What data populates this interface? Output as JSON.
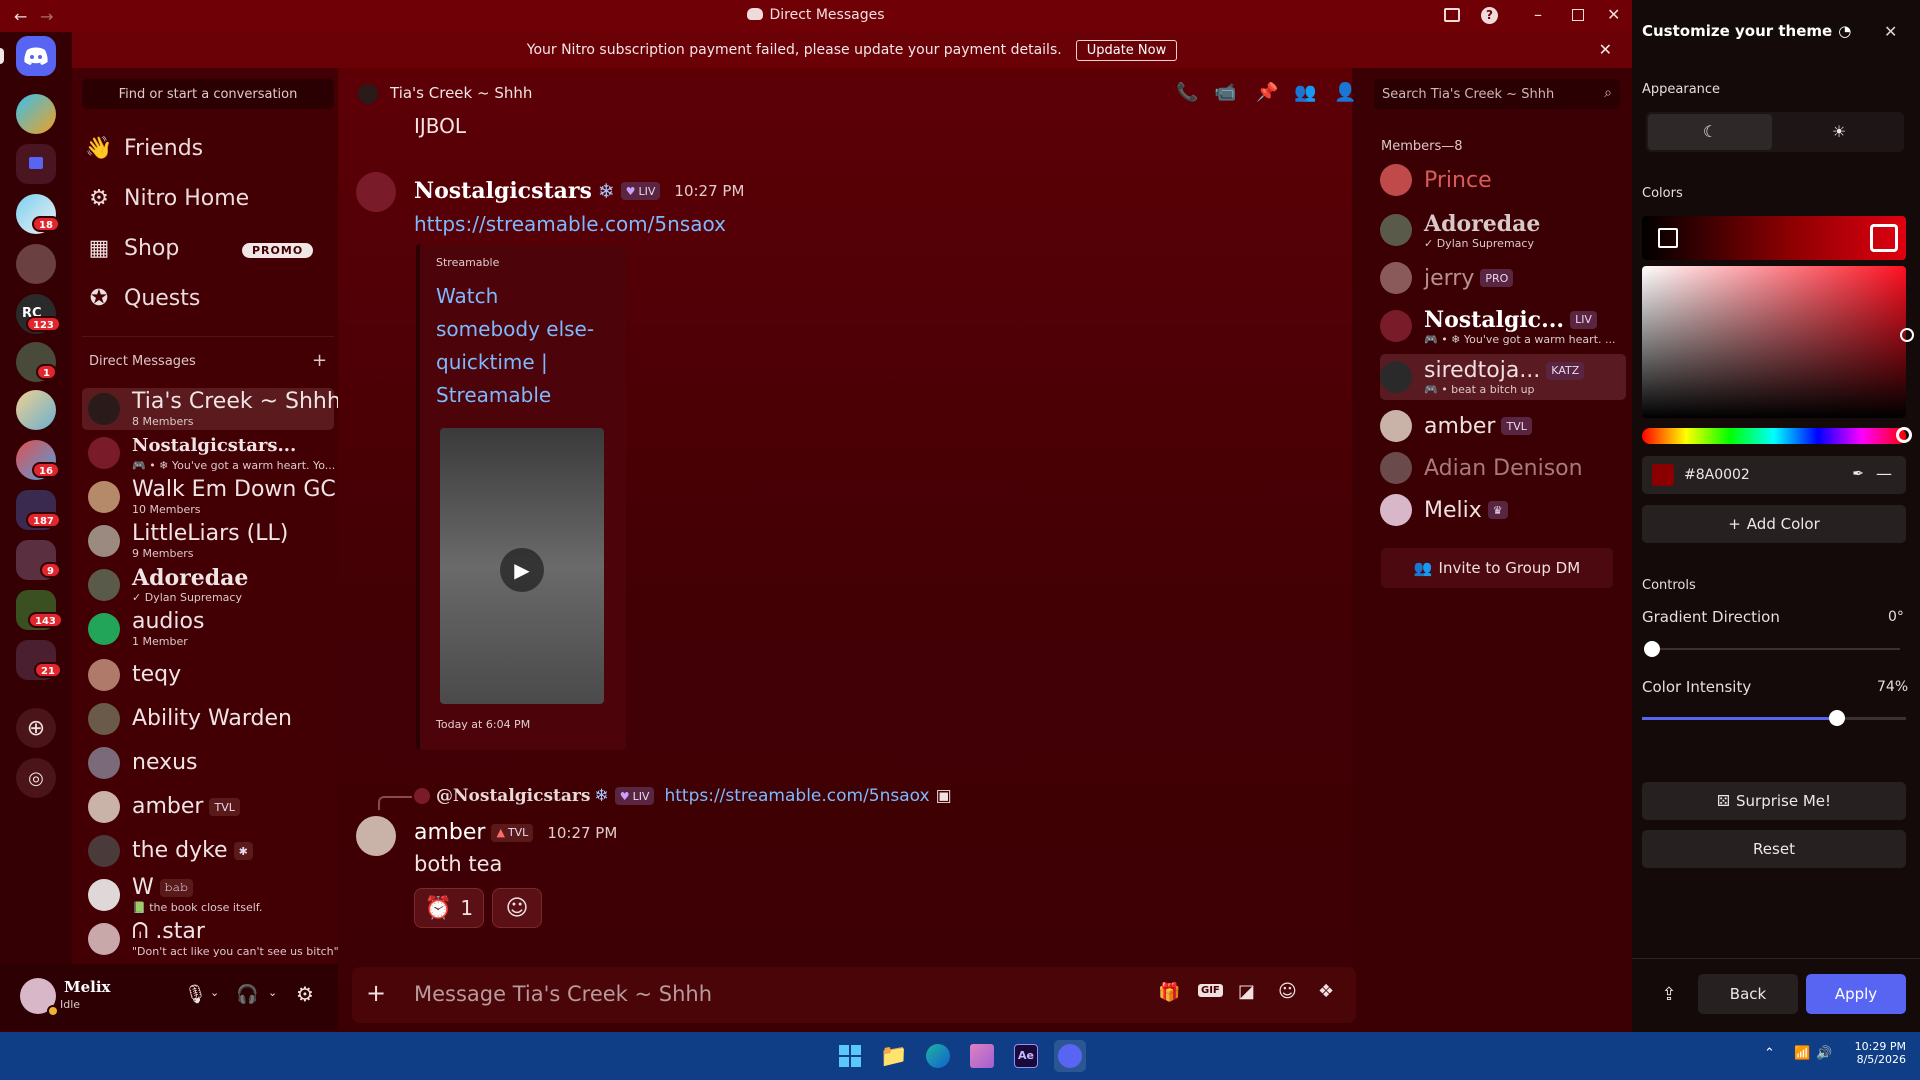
{
  "window": {
    "title": "Direct Messages"
  },
  "banner": {
    "text": "Your Nitro subscription payment failed, please update your payment details.",
    "button": "Update Now"
  },
  "rail": {
    "badges": [
      "18",
      "123",
      "1",
      "16",
      "187",
      "9",
      "143",
      "21"
    ]
  },
  "sidebar": {
    "search_label": "Find or start a conversation",
    "nav": [
      {
        "label": "Friends",
        "icon": "friends-icon"
      },
      {
        "label": "Nitro Home",
        "icon": "nitro-icon"
      },
      {
        "label": "Shop",
        "icon": "shop-icon",
        "badge": "PROMO"
      },
      {
        "label": "Quests",
        "icon": "quests-icon"
      }
    ],
    "dm_header": "Direct Messages",
    "dms": [
      {
        "name": "Tia's Creek ~ Shhh",
        "sub": "8 Members",
        "color": "#2b1a1a"
      },
      {
        "name": "Nostalgicstars...",
        "sub": "🎮 • ❄ You've got a warm heart. Yo...",
        "color": "#7a1b2a"
      },
      {
        "name": "Walk Em Down GC",
        "sub": "10 Members",
        "color": "#b58a6a"
      },
      {
        "name": "LittleLiars (LL)",
        "sub": "9 Members",
        "color": "#9a8a80"
      },
      {
        "name": "Adoredae",
        "sub": "✓ Dylan Supremacy",
        "color": "#5a5a4a"
      },
      {
        "name": "audios",
        "sub": "1 Member",
        "color": "#23a559"
      },
      {
        "name": "teqy",
        "sub": "",
        "color": "#b07a6a"
      },
      {
        "name": "Ability Warden",
        "sub": "",
        "color": "#6a5a4a"
      },
      {
        "name": "nexus",
        "sub": "",
        "color": "#7a6a7a"
      },
      {
        "name": "amber",
        "sub": "",
        "color": "#c9b2a8",
        "tag": "TVL"
      },
      {
        "name": "the dyke",
        "sub": "",
        "color": "#4a3a3a",
        "tag": "✱"
      },
      {
        "name": "W",
        "sub": "📗 the book close itself.",
        "color": "#e0d8d8",
        "tag": "𝚋𝚊𝚋"
      },
      {
        "name": "ᕬ .star",
        "sub": "\"Don't act like you can't see us bitch\"",
        "color": "#c8a8a8"
      }
    ]
  },
  "user": {
    "name": "Melix",
    "status": "Idle"
  },
  "chat": {
    "channel": "Tia's Creek ~ Shhh",
    "search_placeholder": "Search Tia's Creek ~ Shhh",
    "top_text": "IJBOL",
    "msg1": {
      "author": "Nostalgicstars",
      "tag": "LIV",
      "time": "10:27 PM",
      "link": "https://streamable.com/5nsaox"
    },
    "embed": {
      "provider": "Streamable",
      "title": "Watch somebody else-quicktime | Streamable",
      "footer": "Today at 6:04 PM"
    },
    "reply": {
      "author": "@Nostalgicstars",
      "tag": "LIV",
      "link": "https://streamable.com/5nsaox"
    },
    "msg2": {
      "author": "amber",
      "tag": "TVL",
      "time": "10:27 PM",
      "text": "both tea",
      "reaction_count": "1"
    },
    "composer_placeholder": "Message Tia's Creek ~ Shhh"
  },
  "members": {
    "header": "Members—8",
    "list": [
      {
        "name": "Prince",
        "sub": "",
        "color": "#c04a4a",
        "text_color": "#d85a5a"
      },
      {
        "name": "Adoredae",
        "sub": "✓ Dylan Supremacy",
        "color": "#5a5a4a",
        "text_color": "#d8c8c8"
      },
      {
        "name": "jerry",
        "sub": "",
        "color": "#8a5a5a",
        "text_color": "#b89090",
        "tag": "PRO"
      },
      {
        "name": "Nostalgic...",
        "sub": "🎮 • ❄ You've got a warm heart. ...",
        "color": "#7a1b2a",
        "text_color": "#ffffff",
        "tag": "LIV"
      },
      {
        "name": "siredtoja...",
        "sub": "🎮 • beat a bitch up",
        "color": "#2a2a2a",
        "text_color": "#f0e0e0",
        "tag": "KATZ"
      },
      {
        "name": "amber",
        "sub": "",
        "color": "#c9b2a8",
        "text_color": "#f0e0e0",
        "tag": "TVL"
      },
      {
        "name": "Adian Denison",
        "sub": "",
        "color": "#6a4a4a",
        "text_color": "#a87a7a"
      },
      {
        "name": "Melix",
        "sub": "",
        "color": "#d8b8c8",
        "text_color": "#f0e0e0",
        "tag": "♛"
      }
    ],
    "invite": "Invite to Group DM"
  },
  "theme": {
    "title": "Customize your theme",
    "appearance": "Appearance",
    "colors_label": "Colors",
    "hex": "#8A0002",
    "add_color": "Add Color",
    "controls": "Controls",
    "gradient_label": "Gradient Direction",
    "gradient_value": "0°",
    "gradient_fraction": 0.0,
    "intensity_label": "Color Intensity",
    "intensity_value": "74%",
    "intensity_fraction": 0.74,
    "surprise": "Surprise Me!",
    "reset": "Reset",
    "back": "Back",
    "apply": "Apply",
    "accent": "#5865f2"
  },
  "taskbar": {
    "time": "10:29 PM",
    "date": "8/5/2026"
  }
}
